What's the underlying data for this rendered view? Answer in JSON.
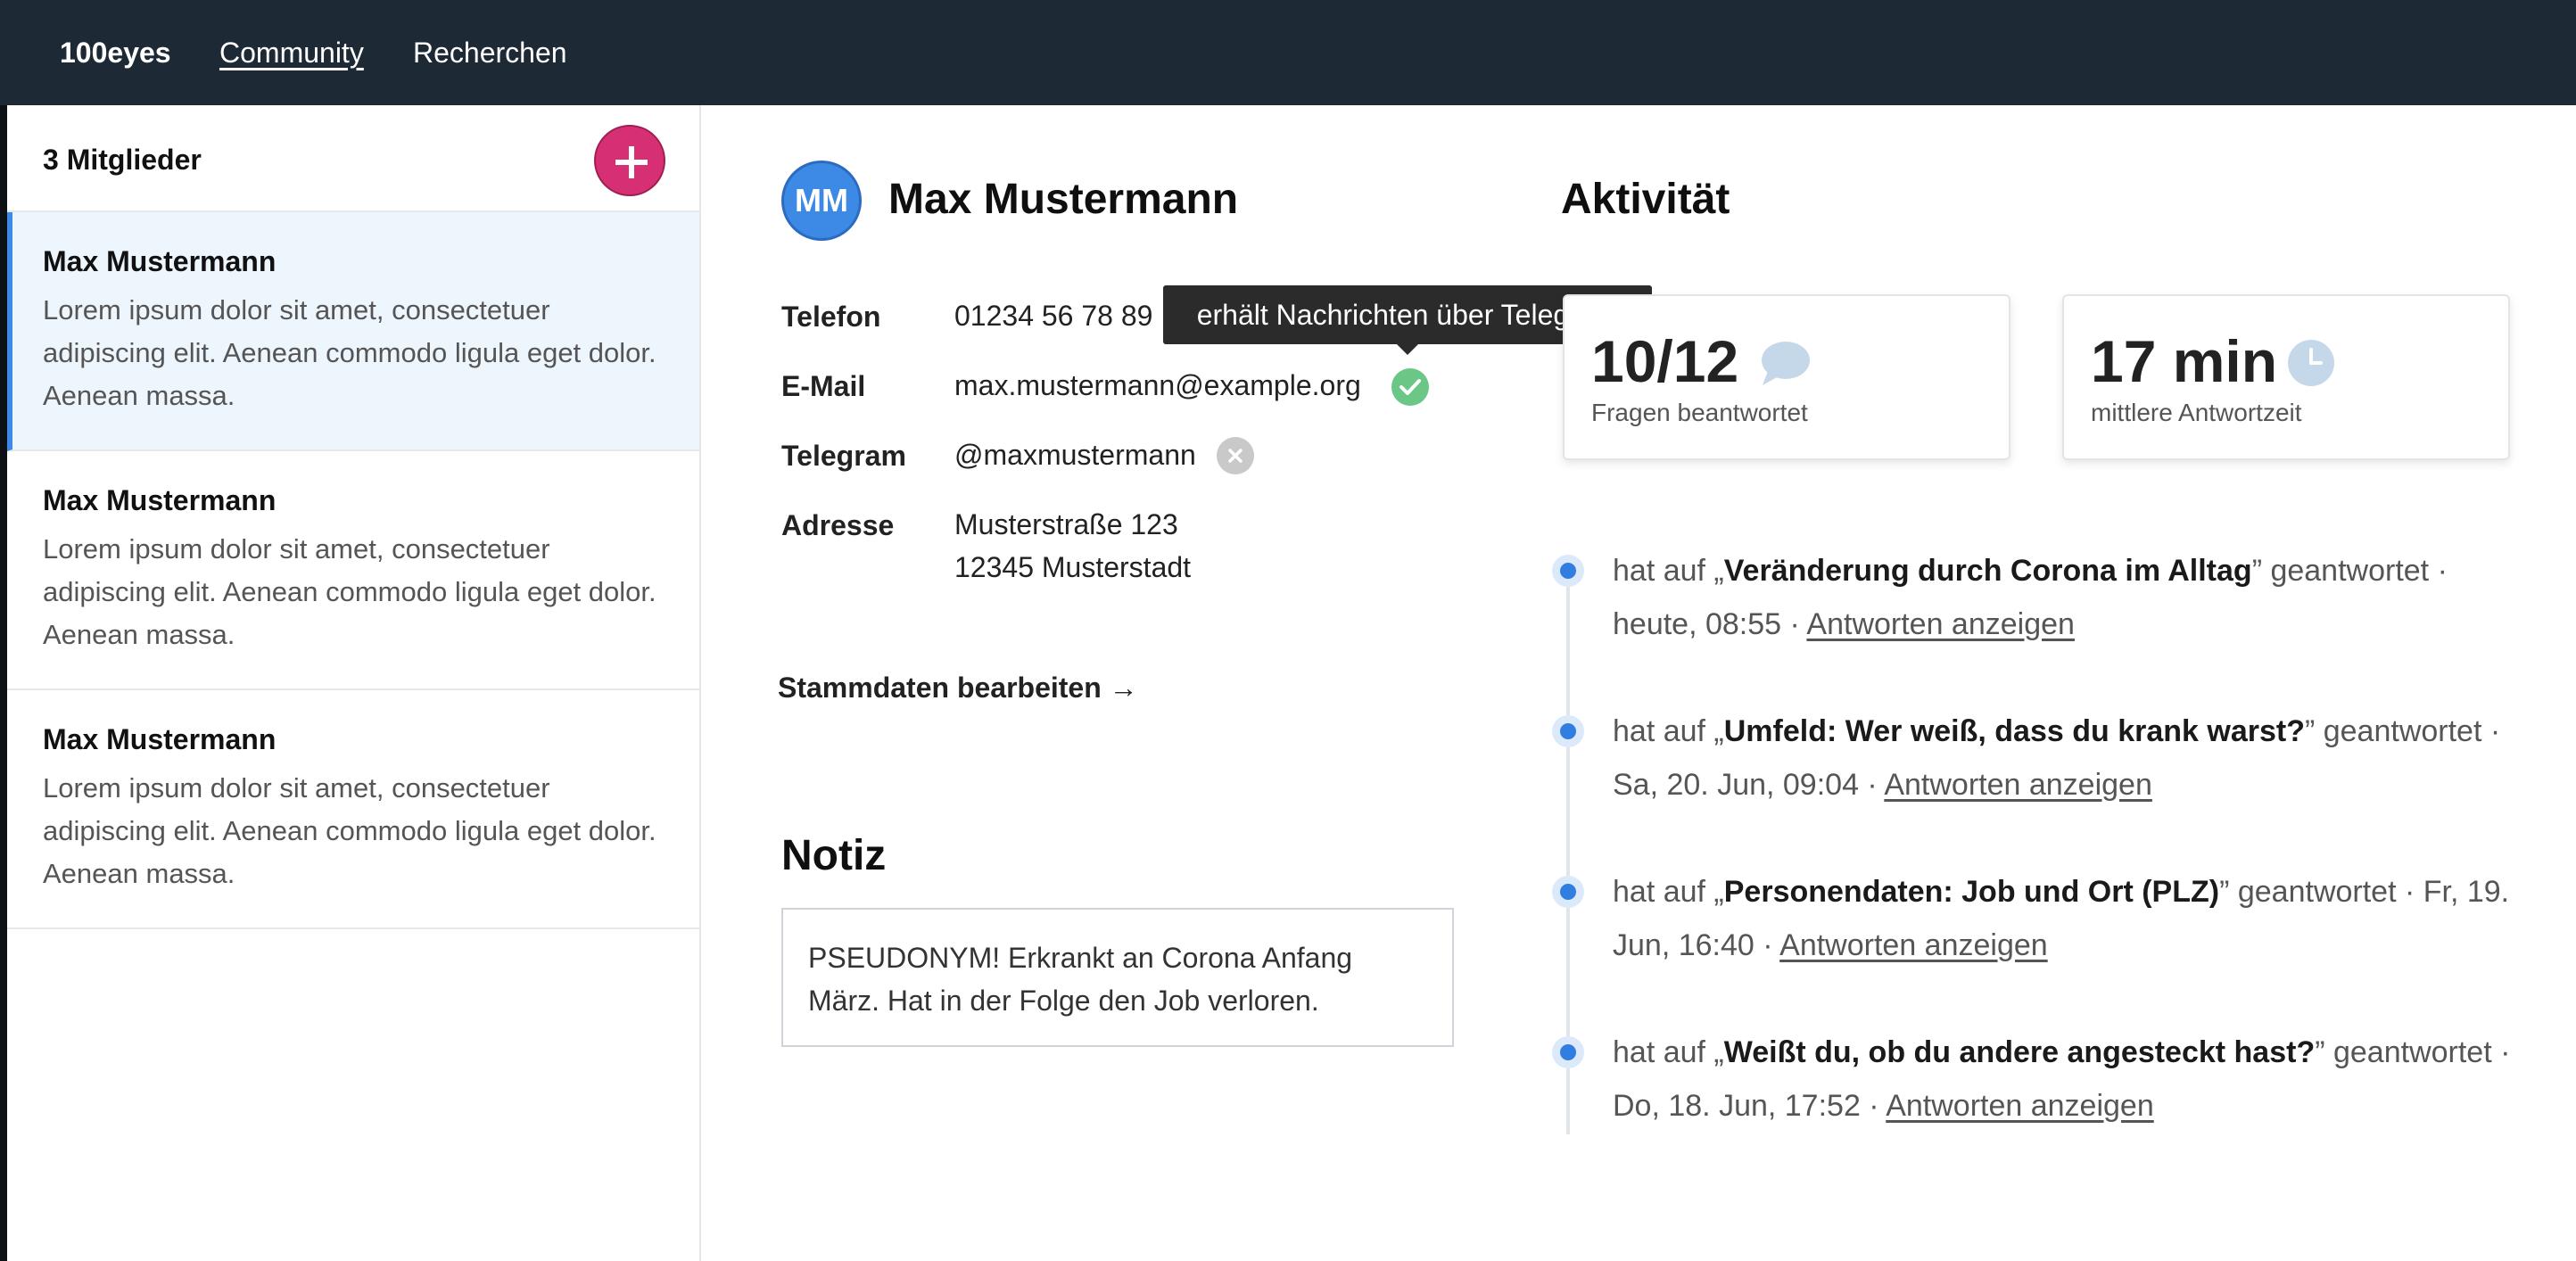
{
  "nav": {
    "brand": "100eyes",
    "links": [
      "Community",
      "Recherchen"
    ]
  },
  "sidebar": {
    "member_count": "3 Mitglieder",
    "members": [
      {
        "name": "Max Mustermann",
        "desc": "Lorem ipsum dolor sit amet, consectetuer adipiscing elit. Aenean commodo ligula eget dolor. Aenean massa."
      },
      {
        "name": "Max Mustermann",
        "desc": "Lorem ipsum dolor sit amet, consectetuer adipiscing elit. Aenean commodo ligula eget dolor. Aenean massa."
      },
      {
        "name": "Max Mustermann",
        "desc": "Lorem ipsum dolor sit amet, consectetuer adipiscing elit. Aenean commodo ligula eget dolor. Aenean massa."
      }
    ]
  },
  "profile": {
    "initials": "MM",
    "name": "Max Mustermann",
    "fields": {
      "phone_label": "Telefon",
      "phone": "01234 56 78 89",
      "email_label": "E-Mail",
      "email": "max.mustermann@example.org",
      "telegram_label": "Telegram",
      "telegram": "@maxmustermann",
      "address_label": "Adresse",
      "address_line1": "Musterstraße 123",
      "address_line2": "12345 Musterstadt"
    },
    "tooltip": "erhält Nachrichten über Telegram",
    "edit_link": "Stammdaten bearbeiten →"
  },
  "notes": {
    "title": "Notiz",
    "text": "PSEUDONYM! Erkrankt an Corona Anfang März. Hat in der Folge den Job verloren."
  },
  "activity": {
    "title": "Aktivität",
    "stats": [
      {
        "value": "10/12",
        "label": "Fragen beantwortet",
        "icon": "speech-bubble-icon"
      },
      {
        "value": "17 min",
        "label": "mittlere Antwortzeit",
        "icon": "clock-icon"
      }
    ],
    "items": [
      {
        "prefix": "hat auf „",
        "question": "Veränderung durch Corona im Alltag",
        "suffix": "” geantwortet · heute, 08:55 · ",
        "link": "Antworten anzeigen"
      },
      {
        "prefix": "hat auf „",
        "question": "Umfeld: Wer weiß, dass du krank warst?",
        "suffix": "” geantwortet · Sa, 20. Jun, 09:04 · ",
        "link": "Antworten anzeigen"
      },
      {
        "prefix": "hat auf „",
        "question": "Personendaten: Job und Ort (PLZ)",
        "suffix": "” geantwortet · Fr, 19. Jun, 16:40 · ",
        "link": "Antworten anzeigen"
      },
      {
        "prefix": "hat auf „",
        "question": "Weißt du, ob du andere angesteckt hast?",
        "suffix": "” geantwortet · Do, 18. Jun, 17:52 · ",
        "link": "Antworten anzeigen"
      }
    ]
  },
  "colors": {
    "topbar": "#1d2935",
    "accent_pink": "#d62f73",
    "accent_blue": "#3d8ae6",
    "check_green": "#6bc786"
  }
}
